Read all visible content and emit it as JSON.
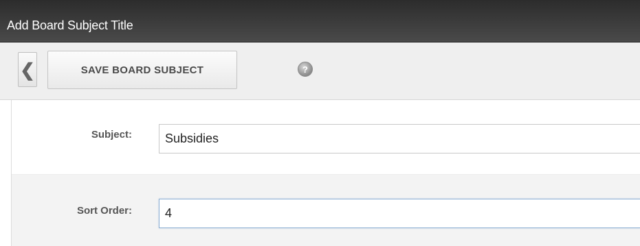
{
  "window": {
    "title": "Add Board Subject Title"
  },
  "toolbar": {
    "back_glyph": "❮",
    "save_label": "SAVE BOARD SUBJECT",
    "help_glyph": "?",
    "icons": {
      "back": "chevron-left-icon",
      "help": "help-icon"
    }
  },
  "form": {
    "subject": {
      "label": "Subject:",
      "value": "Subsidies"
    },
    "sort_order": {
      "label": "Sort Order:",
      "value": "4"
    }
  },
  "colors": {
    "titlebar": "#3a3a3a",
    "toolbar": "#efefef",
    "focus_border": "#8aaed2"
  }
}
